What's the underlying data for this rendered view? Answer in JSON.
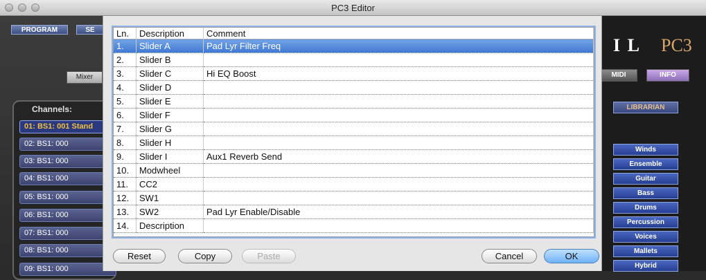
{
  "window": {
    "title": "PC3 Editor"
  },
  "background": {
    "top_tabs": [
      "PROGRAM",
      "SE"
    ],
    "mixer_label": "Mixer",
    "channels_label": "Channels:",
    "channels": [
      "01: BS1: 001 Stand",
      "02: BS1: 000",
      "03: BS1: 000",
      "04: BS1: 000",
      "05: BS1: 000",
      "06: BS1: 000",
      "07: BS1: 000",
      "08: BS1: 000",
      "09: BS1: 000"
    ],
    "logo_mark": "I L",
    "logo_pc3": "PC3",
    "midi_label": "MIDI",
    "info_label": "INFO",
    "librarian_label": "LIBRARIAN",
    "categories": [
      "Winds",
      "Ensemble",
      "Guitar",
      "Bass",
      "Drums",
      "Percussion",
      "Voices",
      "Mallets",
      "Hybrid"
    ]
  },
  "dialog": {
    "columns": [
      "Ln.",
      "Description",
      "Comment"
    ],
    "rows": [
      {
        "ln": "1.",
        "desc": "Slider A",
        "comment": "Pad Lyr Filter Freq"
      },
      {
        "ln": "2.",
        "desc": "Slider B",
        "comment": ""
      },
      {
        "ln": "3.",
        "desc": "Slider C",
        "comment": "Hi EQ Boost"
      },
      {
        "ln": "4.",
        "desc": "Slider D",
        "comment": ""
      },
      {
        "ln": "5.",
        "desc": "Slider E",
        "comment": ""
      },
      {
        "ln": "6.",
        "desc": "Slider F",
        "comment": ""
      },
      {
        "ln": "7.",
        "desc": "Slider G",
        "comment": ""
      },
      {
        "ln": "8.",
        "desc": "Slider H",
        "comment": ""
      },
      {
        "ln": "9.",
        "desc": "Slider I",
        "comment": "Aux1 Reverb Send"
      },
      {
        "ln": "10.",
        "desc": "Modwheel",
        "comment": ""
      },
      {
        "ln": "11.",
        "desc": "CC2",
        "comment": ""
      },
      {
        "ln": "12.",
        "desc": "SW1",
        "comment": ""
      },
      {
        "ln": "13.",
        "desc": "SW2",
        "comment": "Pad Lyr Enable/Disable"
      },
      {
        "ln": "14.",
        "desc": "Description",
        "comment": ""
      }
    ],
    "selected_row": 0,
    "buttons": {
      "reset": "Reset",
      "copy": "Copy",
      "paste": "Paste",
      "cancel": "Cancel",
      "ok": "OK"
    }
  }
}
